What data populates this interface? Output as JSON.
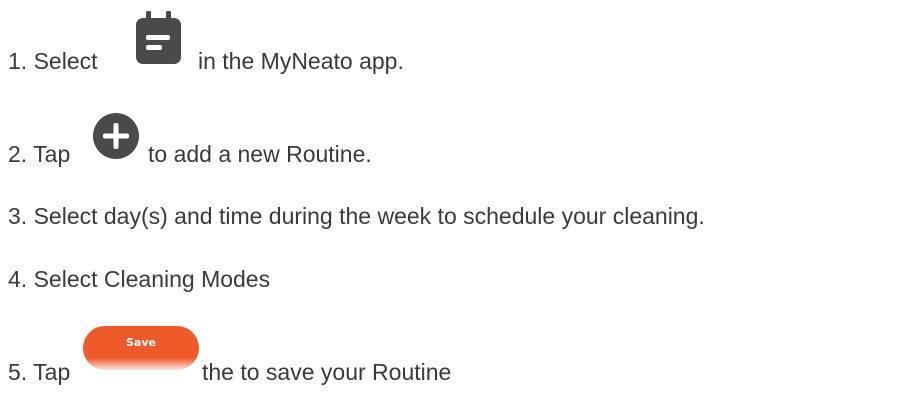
{
  "steps": [
    {
      "prefix": "1. Select",
      "suffix": "in the MyNeato app.",
      "icon": "calendar-icon"
    },
    {
      "prefix": "2. Tap",
      "suffix": "to add a new Routine.",
      "icon": "plus-circle-icon"
    },
    {
      "text": "3. Select day(s) and time during the week to schedule your cleaning."
    },
    {
      "text": "4. Select Cleaning Modes"
    },
    {
      "prefix": "5. Tap",
      "suffix": "the to save your Routine",
      "button_label": "Save"
    }
  ],
  "colors": {
    "text": "#3a3a3a",
    "icon": "#4a4a4a",
    "save_button": "#ee5a2a"
  }
}
